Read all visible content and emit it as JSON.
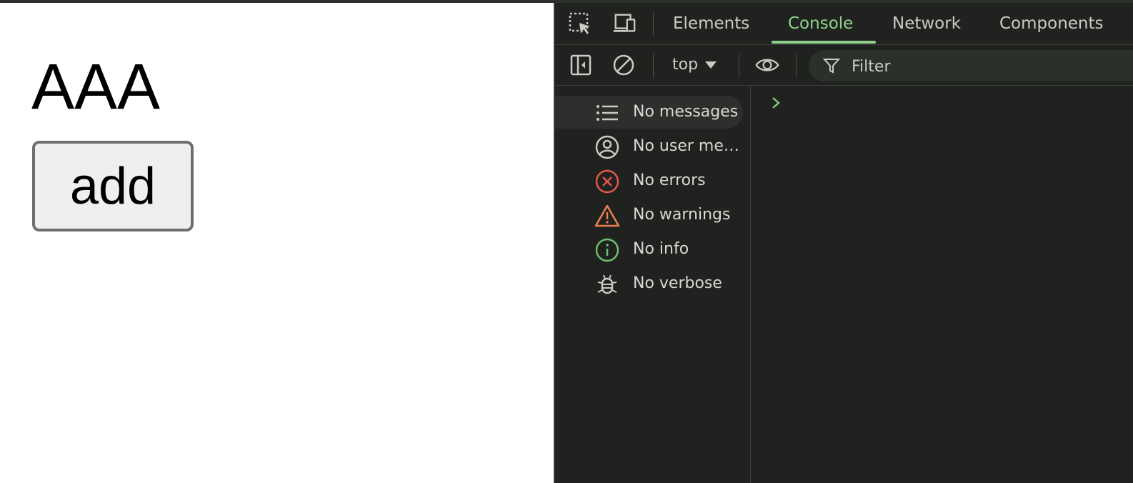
{
  "page": {
    "heading": "AAA",
    "add_button_label": "add"
  },
  "devtools": {
    "tabs": [
      {
        "label": "Elements",
        "active": false
      },
      {
        "label": "Console",
        "active": true
      },
      {
        "label": "Network",
        "active": false
      },
      {
        "label": "Components",
        "active": false
      }
    ],
    "toolbar": {
      "context": "top",
      "filter_placeholder": "Filter"
    },
    "sidebar": [
      {
        "label": "No messages",
        "icon": "list-icon"
      },
      {
        "label": "No user messages",
        "icon": "user-icon"
      },
      {
        "label": "No errors",
        "icon": "error-icon"
      },
      {
        "label": "No warnings",
        "icon": "warning-icon"
      },
      {
        "label": "No info",
        "icon": "info-icon"
      },
      {
        "label": "No verbose",
        "icon": "bug-icon"
      }
    ],
    "colors": {
      "accent": "#8fd18c",
      "error": "#e5574a",
      "warning": "#e8804f",
      "info": "#6fbf73"
    }
  }
}
